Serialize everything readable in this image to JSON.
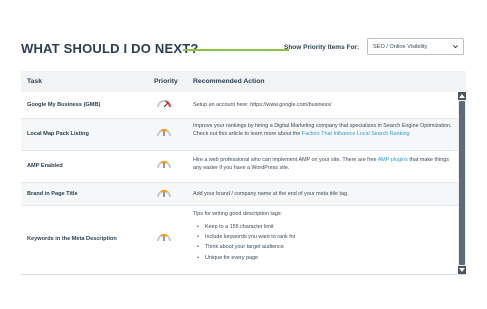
{
  "header": {
    "title": "WHAT SHOULD I DO NEXT?",
    "show_label": "Show Priority Items For:",
    "select_value": "SEO / Online Visibility"
  },
  "table": {
    "columns": {
      "task": "Task",
      "priority": "Priority",
      "action": "Recommended Action"
    },
    "rows": [
      {
        "task": "Google My Business (GMB)",
        "priority": "high",
        "action_text": "Setup an account here: https://www.google.com/business/"
      },
      {
        "task": "Local Map Pack Listing",
        "priority": "medium",
        "action_text": "Improve your rankings by hiring a Digital Marketing company that specializes in Search Engine Optimization. Check out this article to learn more about the ",
        "action_link": "Factors That Influence Local Search Ranking"
      },
      {
        "task": "AMP Enabled",
        "priority": "medium",
        "action_text": "Hire a web professional who can implement AMP on your site. There are free ",
        "action_link": "AMP plugins",
        "action_text_after": " that make things any easier if you have a WordPress site."
      },
      {
        "task": "Brand in Page Title",
        "priority": "medium",
        "action_text": "Add your brand / company name at the end of your meta title tag."
      },
      {
        "task": "Keywords in the Meta Description",
        "priority": "medium",
        "action_text": "Tips for writing good description tags:",
        "tips": [
          "Keep to a 155 character limit",
          "Include keywords you want to rank for",
          "Think about your target audience",
          "Unique for every page"
        ]
      }
    ]
  },
  "colors": {
    "accent_green": "#8bc34a",
    "link": "#2a9fd6",
    "heading": "#2c3e50",
    "gauge_red": "#e53935",
    "gauge_orange": "#f39c12"
  },
  "icons": {
    "select": "chevron-down-icon",
    "priority": "priority-gauge-icon",
    "scroll_up": "scroll-up-arrow-icon",
    "scroll_down": "scroll-down-arrow-icon"
  }
}
